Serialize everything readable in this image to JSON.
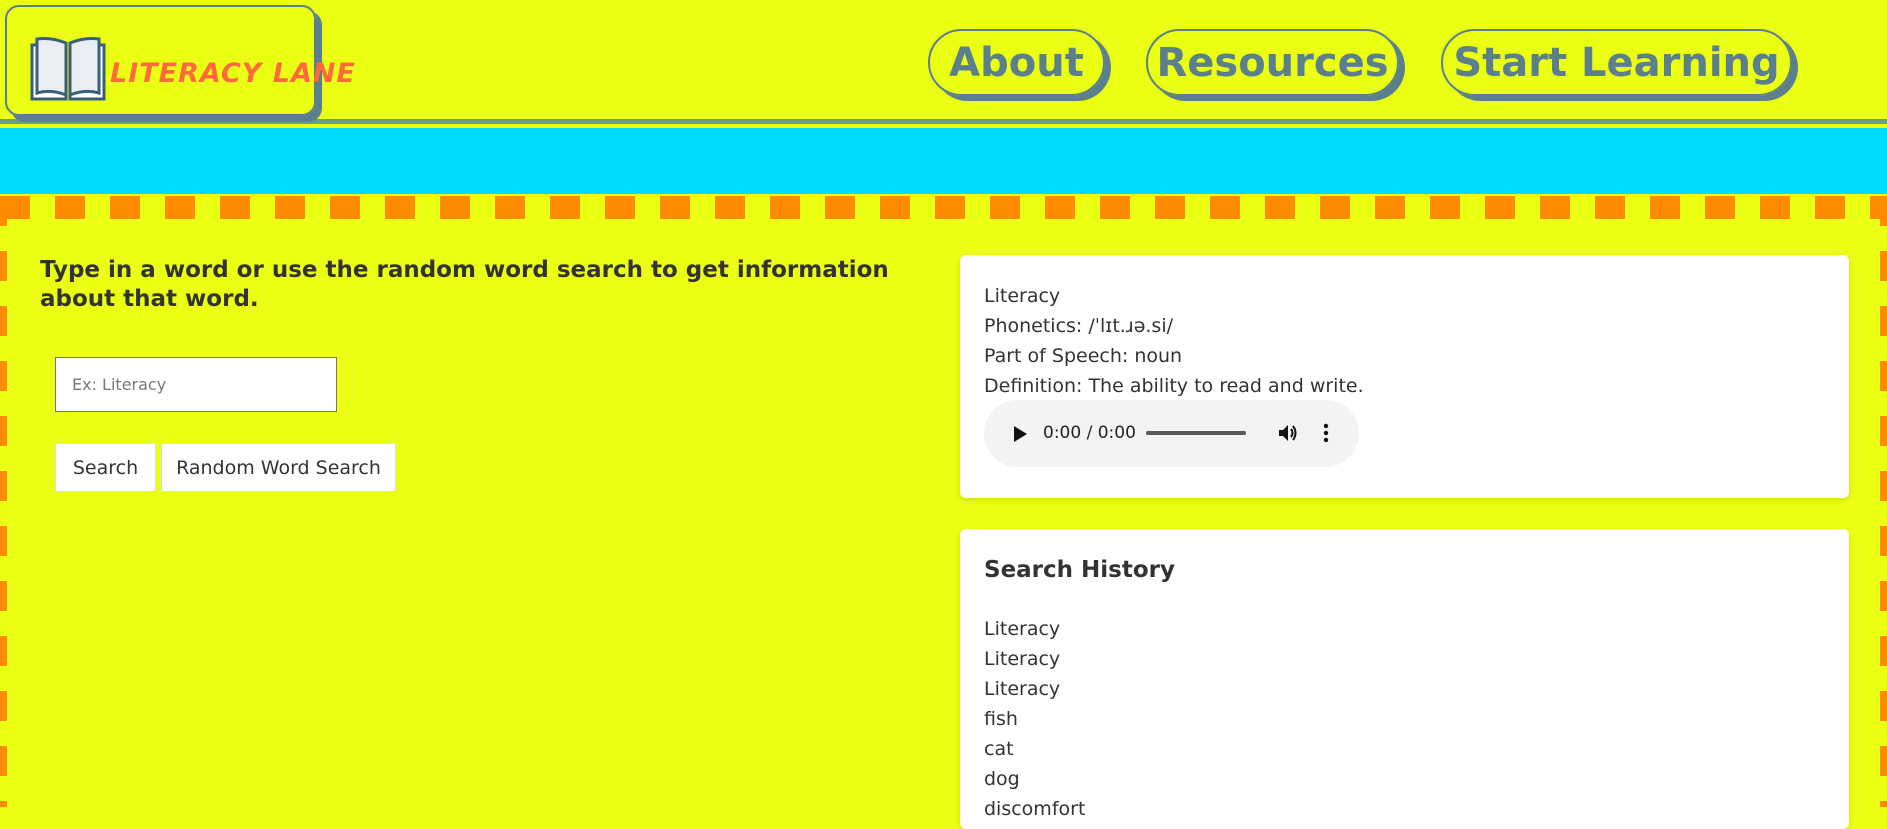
{
  "header": {
    "logo_text": "LITERACY LANE",
    "logo_icon": "open-book-icon",
    "nav": [
      {
        "label": "About"
      },
      {
        "label": "Resources"
      },
      {
        "label": "Start Learning"
      }
    ]
  },
  "colors": {
    "page_background": "#eaff14",
    "banner": "#00dcff",
    "dash_border": "#ff8c00",
    "nav_accent": "#5c7f8e",
    "logo_text": "#ff6a3d"
  },
  "search": {
    "instructions": "Type in a word or use the random word search to get information about that word.",
    "placeholder": "Ex: Literacy",
    "value": "",
    "search_label": "Search",
    "random_label": "Random Word Search"
  },
  "result": {
    "word": "Literacy",
    "phonetics": "Phonetics: /ˈlɪt.ɹə.si/",
    "part_of_speech": "Part of Speech: noun",
    "definition": "Definition: The ability to read and write.",
    "audio": {
      "time": "0:00 / 0:00",
      "play_icon": "play-icon",
      "volume_icon": "volume-icon",
      "more_icon": "more-vertical-icon"
    }
  },
  "history": {
    "title": "Search History",
    "items": [
      "Literacy",
      "Literacy",
      "Literacy",
      "fish",
      "cat",
      "dog",
      "discomfort"
    ]
  }
}
